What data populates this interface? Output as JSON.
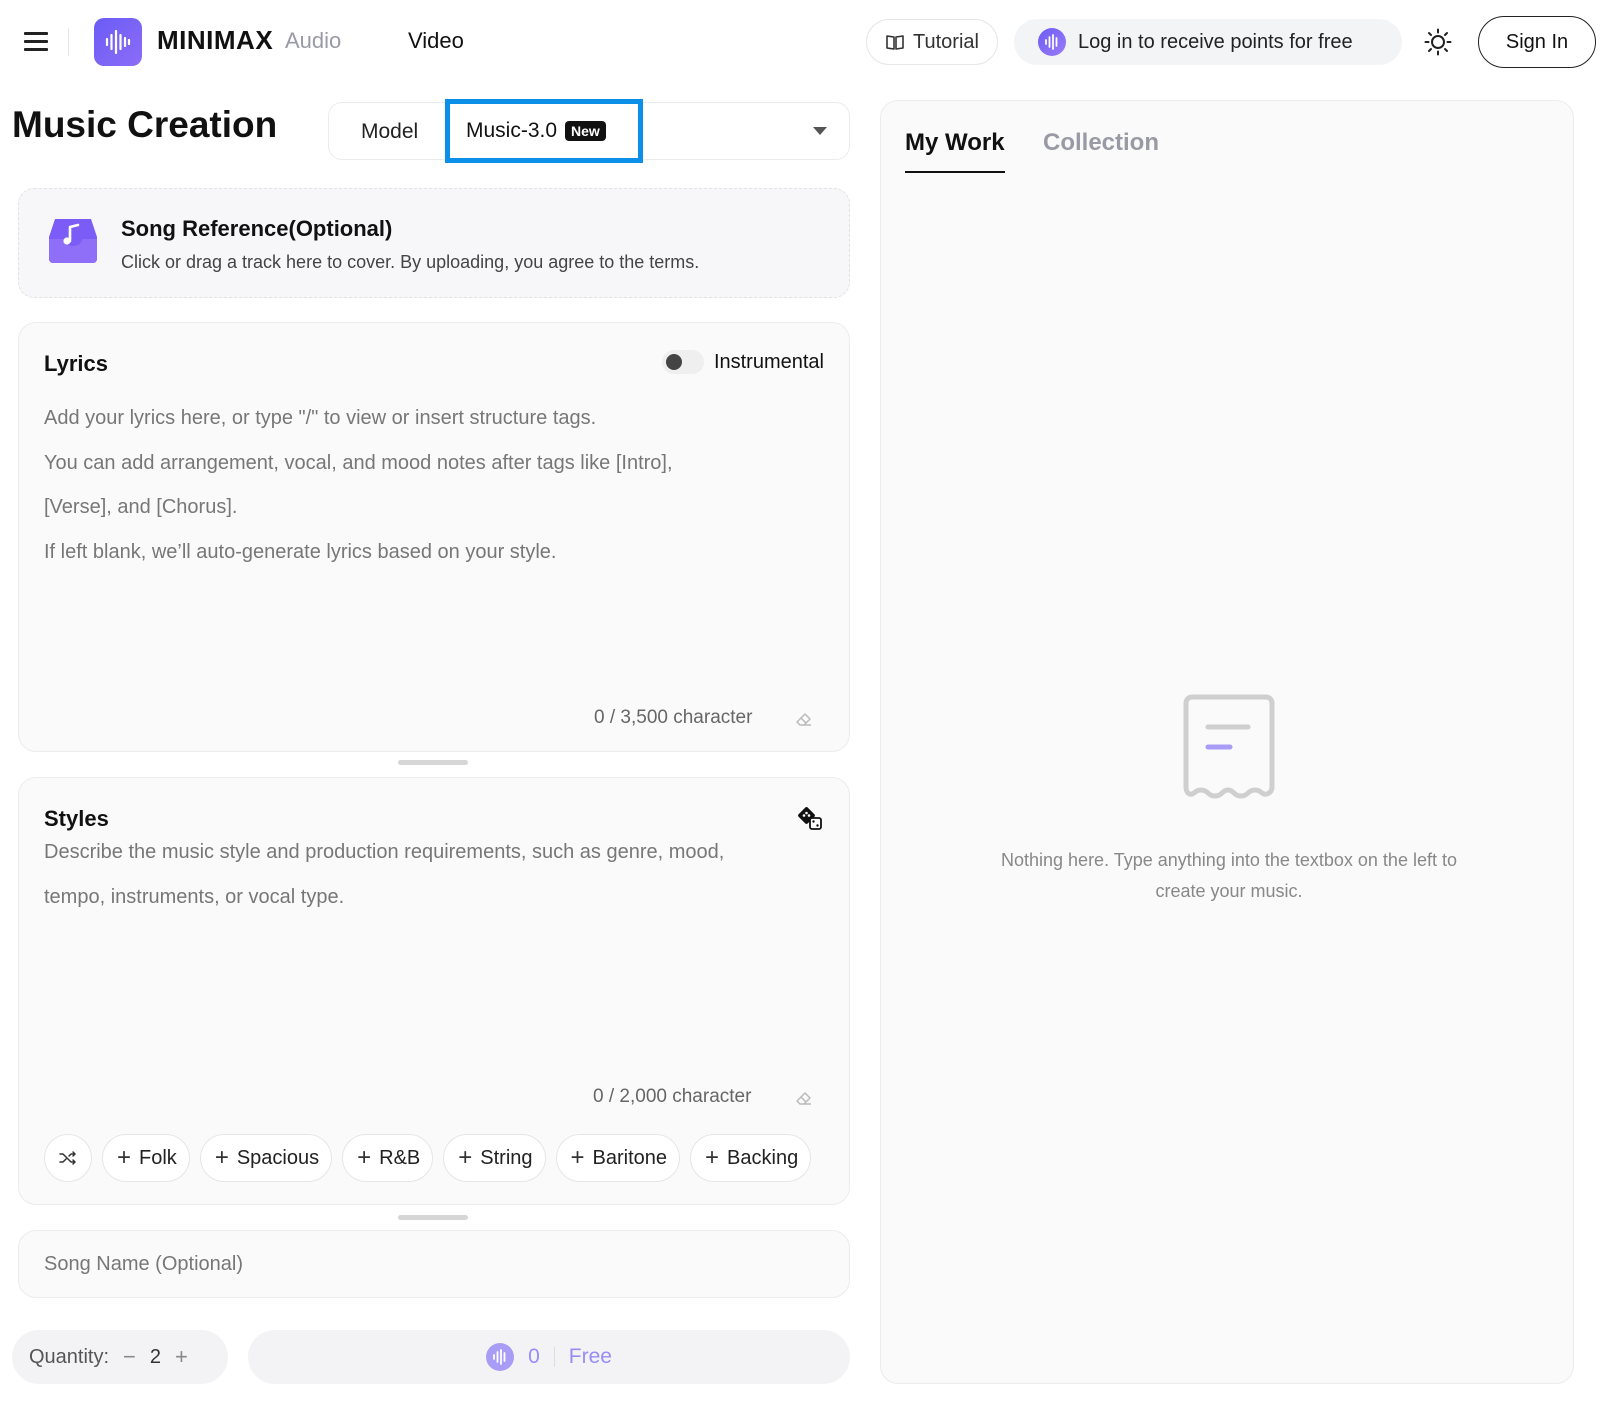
{
  "header": {
    "logo_text": "MINIMAX",
    "nav": {
      "audio": "Audio",
      "video": "Video"
    },
    "tutorial_label": "Tutorial",
    "points_label": "Log in to receive points for free",
    "signin_label": "Sign In"
  },
  "left": {
    "page_title": "Music Creation",
    "model": {
      "label": "Model",
      "selected": "Music-3.0",
      "badge": "New"
    },
    "song_reference": {
      "title": "Song Reference(Optional)",
      "description": "Click or drag a track here to cover. By uploading, you agree to the terms."
    },
    "lyrics": {
      "title": "Lyrics",
      "instrumental_label": "Instrumental",
      "placeholder_lines": [
        "Add your lyrics here, or type \"/\" to view or insert structure tags.",
        "You can add arrangement, vocal, and mood notes after tags like [Intro],",
        "[Verse], and [Chorus].",
        "If left blank, we’ll auto-generate lyrics based on your style."
      ],
      "char_count": "0 / 3,500 character"
    },
    "styles": {
      "title": "Styles",
      "placeholder_lines": [
        "Describe the music style and production requirements, such as genre, mood,",
        "tempo, instruments, or vocal type."
      ],
      "char_count": "0 / 2,000 character",
      "tags": [
        "Folk",
        "Spacious",
        "R&B",
        "String",
        "Baritone",
        "Backing"
      ]
    },
    "song_name_placeholder": "Song Name (Optional)",
    "quantity": {
      "label": "Quantity:",
      "minus": "−",
      "value": "2",
      "plus": "+"
    },
    "generate": {
      "cost": "0",
      "label": "Free"
    }
  },
  "right": {
    "tabs": {
      "my_work": "My Work",
      "collection": "Collection"
    },
    "empty_text": "Nothing here. Type anything into the textbox on the left to create your music."
  },
  "colors": {
    "brand": "#6b5cf6",
    "highlight_border": "#0b8fe8"
  },
  "icons": [
    "menu-icon",
    "minimax-logo-icon",
    "book-icon",
    "sound-wave-icon",
    "sun-icon",
    "music-upload-icon",
    "eraser-icon",
    "dice-icon",
    "shuffle-icon",
    "plus-icon",
    "empty-document-icon"
  ]
}
